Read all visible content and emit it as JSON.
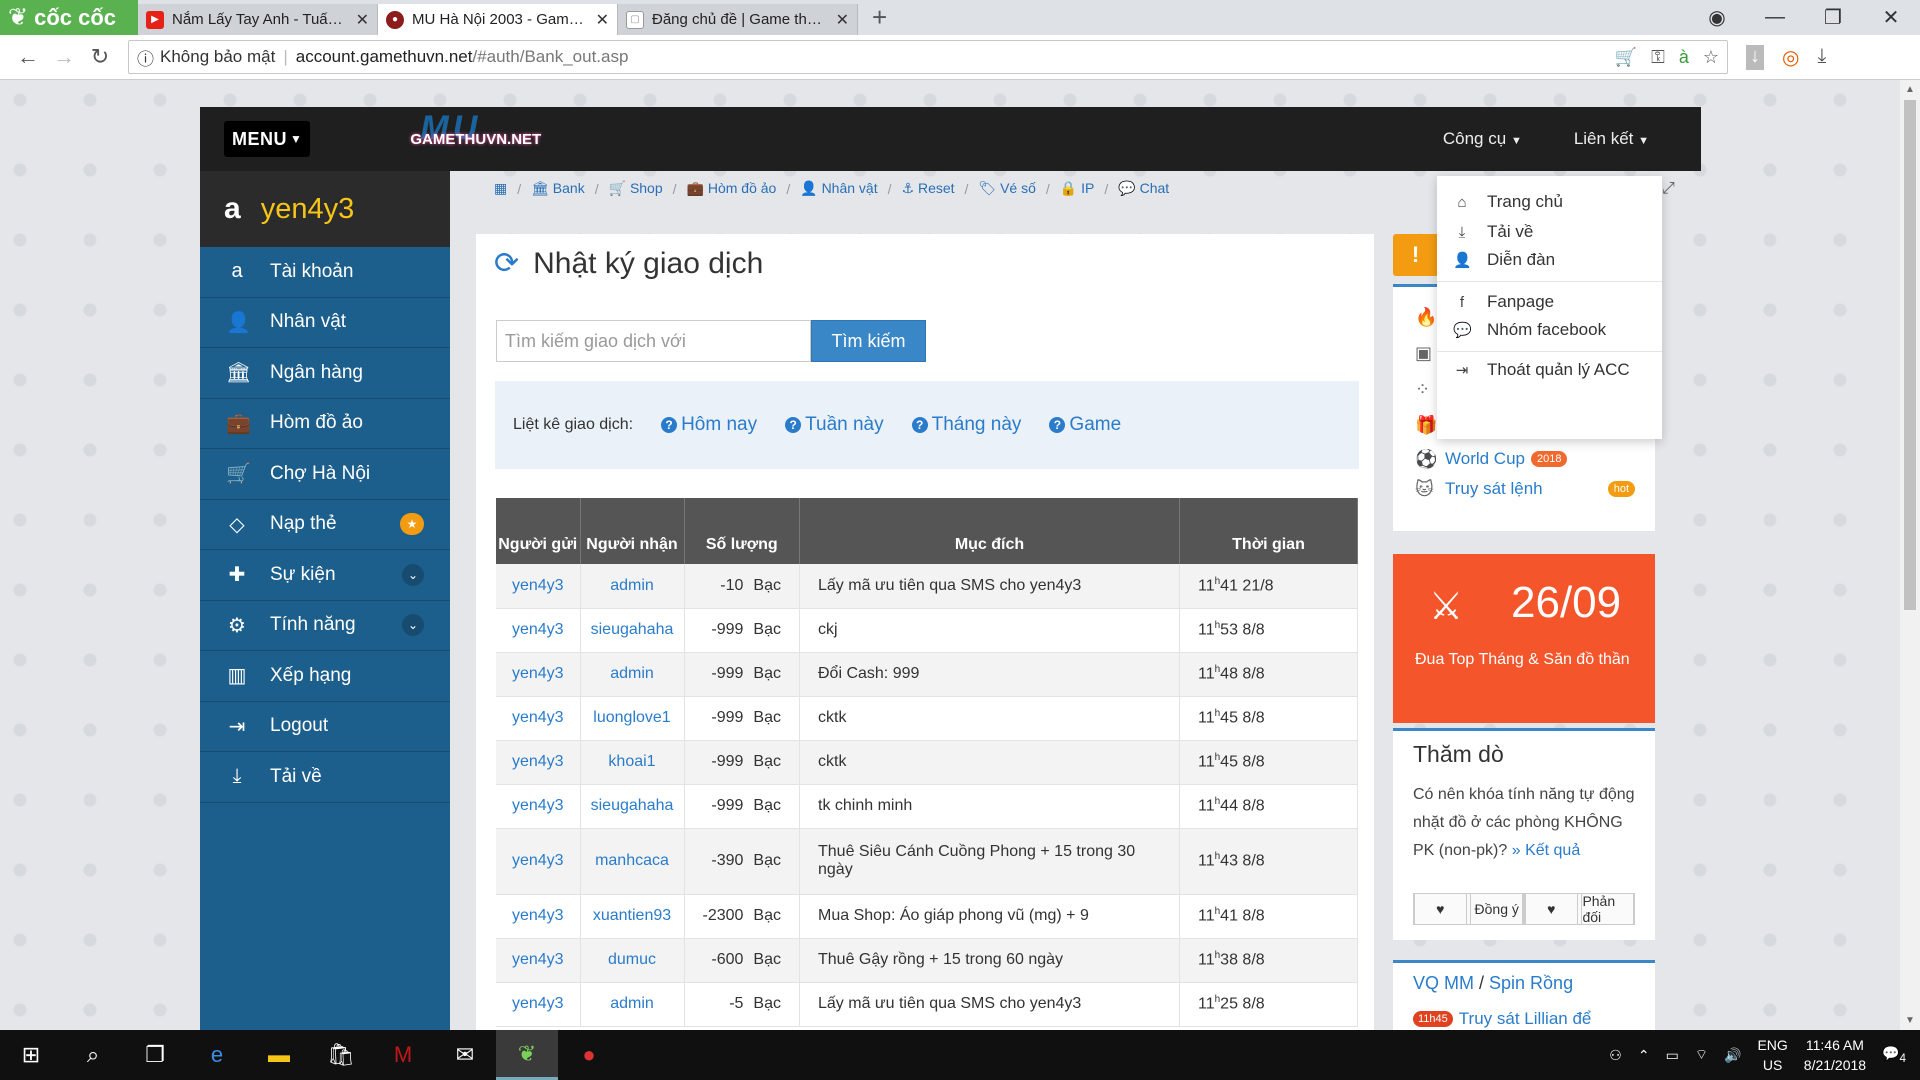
{
  "browser": {
    "brand": "cốc cốc",
    "tabs": [
      {
        "title": "Nắm Lấy Tay Anh - Tuấn H",
        "icon": "youtube-icon"
      },
      {
        "title": "MU Hà Nội 2003 - Gameth",
        "icon": "mu-icon"
      },
      {
        "title": "Đăng chủ đề | Game thủ V",
        "icon": "page-icon"
      }
    ],
    "security": "Không bảo mật",
    "url_host": "account.gamethuvn.net",
    "url_path": "/#auth/Bank_out.asp"
  },
  "topnav": {
    "menu_label": "MENU",
    "logo_big": "MU",
    "logo_text": "GAMETHUVN.NET",
    "tools": "Công cụ",
    "links": "Liên kết"
  },
  "sidebar": {
    "username": "yen4y3",
    "items": [
      {
        "label": "Tài khoản",
        "icon": "account-icon"
      },
      {
        "label": "Nhân vật",
        "icon": "user-icon"
      },
      {
        "label": "Ngân hàng",
        "icon": "bank-icon"
      },
      {
        "label": "Hòm đồ ảo",
        "icon": "briefcase-icon"
      },
      {
        "label": "Chợ Hà Nội",
        "icon": "cart-icon"
      },
      {
        "label": "Nạp thẻ",
        "icon": "diamond-icon"
      },
      {
        "label": "Sự kiện",
        "icon": "puzzle-icon"
      },
      {
        "label": "Tính năng",
        "icon": "gears-icon"
      },
      {
        "label": "Xếp hạng",
        "icon": "bar-chart-icon"
      },
      {
        "label": "Logout",
        "icon": "sign-out-icon"
      },
      {
        "label": "Tải về",
        "icon": "download-icon"
      }
    ]
  },
  "breadcrumb": [
    "Bank",
    "Shop",
    "Hòm đồ ảo",
    "Nhân vật",
    "Reset",
    "Vé số",
    "IP",
    "Chat"
  ],
  "main": {
    "title": "Nhật ký giao dịch",
    "search_placeholder": "Tìm kiếm giao dịch với",
    "search_button": "Tìm kiếm",
    "filter_label": "Liệt kê giao dịch:",
    "filters": [
      "Hôm nay",
      "Tuần này",
      "Tháng này",
      "Game"
    ]
  },
  "table": {
    "headers": {
      "sender": "Người gửi",
      "receiver": "Người nhận",
      "amount": "Số lượng",
      "purpose": "Mục đích",
      "time": "Thời gian"
    },
    "currency": "Bạc",
    "rows": [
      {
        "sender": "yen4y3",
        "receiver": "admin",
        "amount": "-10",
        "purpose": "Lấy mã ưu tiên qua SMS cho yen4y3",
        "hour": "11",
        "rest": "41 21/8"
      },
      {
        "sender": "yen4y3",
        "receiver": "sieugahaha",
        "amount": "-999",
        "purpose": "ckj",
        "hour": "11",
        "rest": "53 8/8"
      },
      {
        "sender": "yen4y3",
        "receiver": "admin",
        "amount": "-999",
        "purpose": "Đổi Cash: 999",
        "hour": "11",
        "rest": "48 8/8"
      },
      {
        "sender": "yen4y3",
        "receiver": "luonglove1",
        "amount": "-999",
        "purpose": "cktk",
        "hour": "11",
        "rest": "45 8/8"
      },
      {
        "sender": "yen4y3",
        "receiver": "khoai1",
        "amount": "-999",
        "purpose": "cktk",
        "hour": "11",
        "rest": "45 8/8"
      },
      {
        "sender": "yen4y3",
        "receiver": "sieugahaha",
        "amount": "-999",
        "purpose": "tk chinh minh",
        "hour": "11",
        "rest": "44 8/8"
      },
      {
        "sender": "yen4y3",
        "receiver": "manhcaca",
        "amount": "-390",
        "purpose": "Thuê Siêu Cánh Cuồng Phong + 15 trong 30 ngày",
        "hour": "11",
        "rest": "43 8/8"
      },
      {
        "sender": "yen4y3",
        "receiver": "xuantien93",
        "amount": "-2300",
        "purpose": "Mua Shop: Áo giáp phong vũ (mg) + 9",
        "hour": "11",
        "rest": "41 8/8"
      },
      {
        "sender": "yen4y3",
        "receiver": "dumuc",
        "amount": "-600",
        "purpose": "Thuê Gậy rồng + 15 trong 60 ngày",
        "hour": "11",
        "rest": "38 8/8"
      },
      {
        "sender": "yen4y3",
        "receiver": "admin",
        "amount": "-5",
        "purpose": "Lấy mã ưu tiên qua SMS cho yen4y3",
        "hour": "11",
        "rest": "25 8/8"
      }
    ],
    "time_marker": "h"
  },
  "right": {
    "worldcup": "World Cup",
    "worldcup_badge": "2018",
    "truysat": "Truy sát lệnh",
    "truysat_badge": "hot",
    "promo_date": "26/09",
    "promo_caption": "Đua Top Tháng & Săn đồ thần",
    "poll_title": "Thăm dò",
    "poll_question": "Có nên khóa tính năng tự động nhặt đồ ở các phòng KHÔNG PK (non-pk)?",
    "poll_result": "» Kết quả",
    "poll_agree": "Đồng ý",
    "poll_disagree": "Phản đối",
    "vq_a": "VQ MM",
    "vq_sep": " / ",
    "vq_b": "Spin Rồng",
    "event_time": "11h45",
    "event_text": "Truy sát Lillian để"
  },
  "dropdown": {
    "items": [
      "Trang chủ",
      "Tải về",
      "Diễn đàn",
      "Fanpage",
      "Nhóm facebook",
      "Thoát quản lý ACC"
    ]
  },
  "taskbar": {
    "lang_top": "ENG",
    "lang_bottom": "US",
    "time": "11:46 AM",
    "date": "8/21/2018",
    "notifications": "4"
  }
}
